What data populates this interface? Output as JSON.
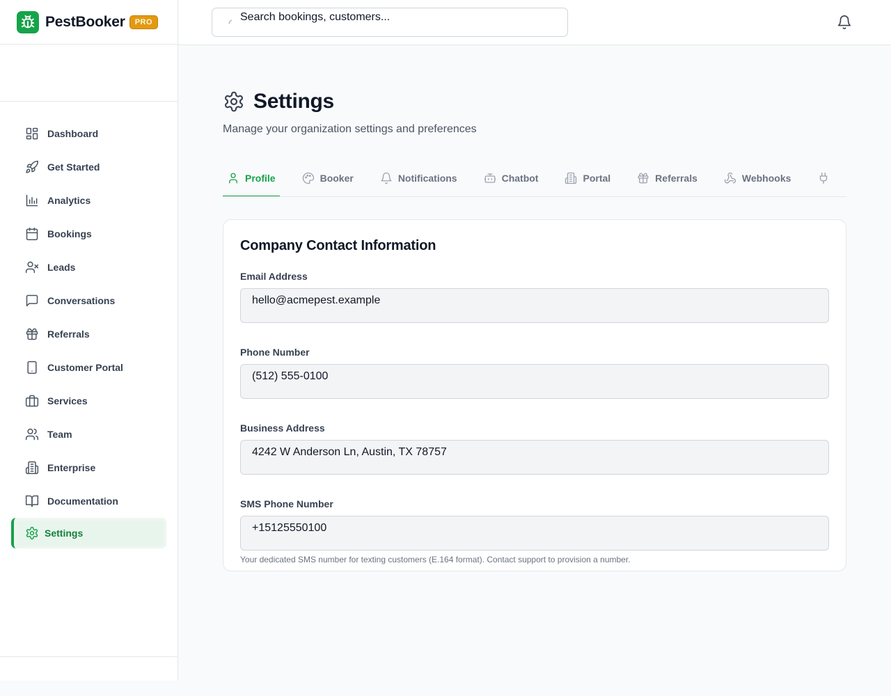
{
  "brand": {
    "name": "PestBooker",
    "badge": "PRO"
  },
  "search": {
    "value": "Search bookings, customers..."
  },
  "sidebar": {
    "items": [
      {
        "label": "Dashboard",
        "icon": "dashboard-icon"
      },
      {
        "label": "Get Started",
        "icon": "rocket-icon"
      },
      {
        "label": "Analytics",
        "icon": "bar-chart-icon"
      },
      {
        "label": "Bookings",
        "icon": "calendar-icon"
      },
      {
        "label": "Leads",
        "icon": "user-x-icon"
      },
      {
        "label": "Conversations",
        "icon": "message-icon"
      },
      {
        "label": "Referrals",
        "icon": "gift-icon"
      },
      {
        "label": "Customer Portal",
        "icon": "tablet-icon"
      },
      {
        "label": "Services",
        "icon": "briefcase-icon"
      },
      {
        "label": "Team",
        "icon": "users-icon"
      },
      {
        "label": "Enterprise",
        "icon": "building-icon"
      },
      {
        "label": "Documentation",
        "icon": "book-icon"
      },
      {
        "label": "Settings",
        "icon": "gear-icon",
        "active": true
      }
    ]
  },
  "page": {
    "title": "Settings",
    "subtitle": "Manage your organization settings and preferences"
  },
  "tabs": [
    {
      "label": "Profile",
      "icon": "user-icon",
      "active": true
    },
    {
      "label": "Booker",
      "icon": "palette-icon"
    },
    {
      "label": "Notifications",
      "icon": "bell-icon"
    },
    {
      "label": "Chatbot",
      "icon": "bot-icon"
    },
    {
      "label": "Portal",
      "icon": "building-icon"
    },
    {
      "label": "Referrals",
      "icon": "gift-icon"
    },
    {
      "label": "Webhooks",
      "icon": "webhook-icon"
    },
    {
      "label": "",
      "icon": "plug-icon"
    }
  ],
  "card": {
    "title": "Company Contact Information",
    "fields": [
      {
        "label": "Email Address",
        "value": "hello@acmepest.example"
      },
      {
        "label": "Phone Number",
        "value": "(512) 555-0100"
      },
      {
        "label": "Business Address",
        "value": "4242 W Anderson Ln, Austin, TX 78757"
      },
      {
        "label": "SMS Phone Number",
        "value": "+15125550100",
        "help": "Your dedicated SMS number for texting customers (E.164 format). Contact support to provision a number."
      }
    ]
  },
  "colors": {
    "accent": "#16a34a",
    "badge": "#e29a12",
    "text": "#111827",
    "muted": "#6b7280"
  }
}
